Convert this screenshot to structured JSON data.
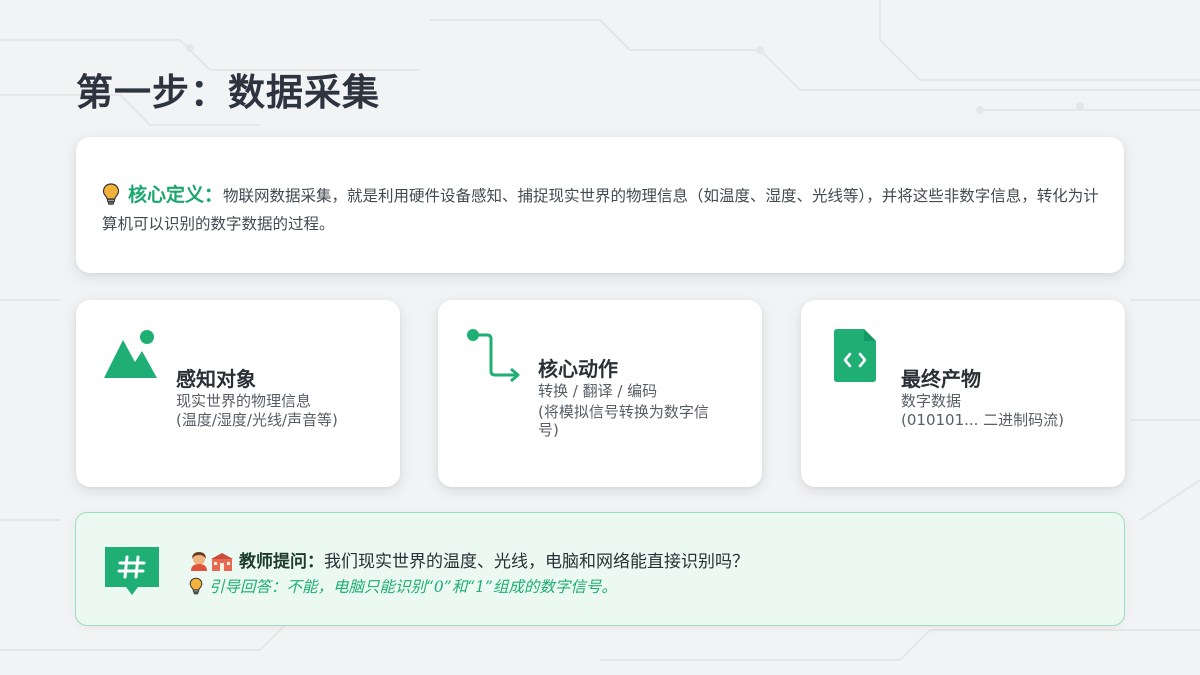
{
  "page": {
    "title": "第一步：数据采集"
  },
  "definition": {
    "icon": "lightbulb-icon",
    "label": "核心定义：",
    "text": "物联网数据采集，就是利用硬件设备感知、捕捉现实世界的物理信息（如温度、湿度、光线等），并将这些非数字信息，转化为计算机可以识别的数字数据的过程。"
  },
  "cards": [
    {
      "icon": "mountain-image-icon",
      "title": "感知对象",
      "lines": [
        "现实世界的物理信息",
        "(温度/湿度/光线/声音等)"
      ]
    },
    {
      "icon": "flow-arrow-icon",
      "title": "核心动作",
      "lines": [
        "转换 / 翻译 / 编码",
        "(将模拟信号转换为数字信",
        "号)"
      ]
    },
    {
      "icon": "code-file-icon",
      "title": "最终产物",
      "lines": [
        "数字数据",
        "(010101... 二进制码流)"
      ]
    }
  ],
  "question": {
    "icon": "hashtag-icon",
    "label": "教师提问：",
    "text": "我们现实世界的温度、光线，电脑和网络能直接识别吗？",
    "answer": "引导回答：不能，电脑只能识别“0”和“1”组成的数字信号。"
  },
  "colors": {
    "accent": "#1fae74",
    "accent_dark": "#169a63",
    "title": "#2d3440",
    "question_bg": "#ecf9f2",
    "question_border": "#9fdcbd"
  }
}
